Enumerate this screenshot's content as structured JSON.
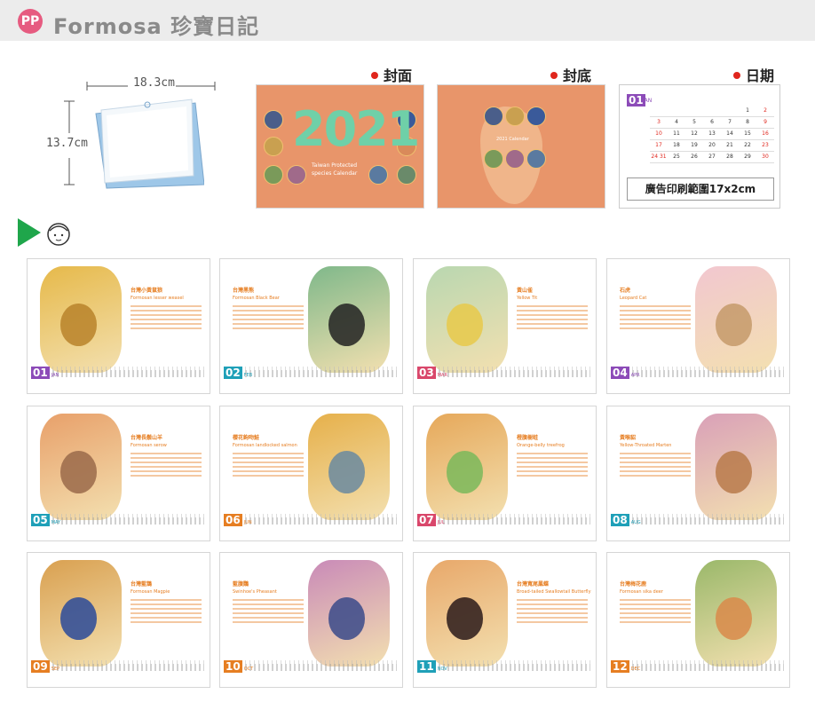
{
  "header": {
    "logo": "PP",
    "title": "Formosa 珍寶日記"
  },
  "dimensions": {
    "width": "18.3cm",
    "height": "13.7cm"
  },
  "sections": [
    {
      "label": "封面"
    },
    {
      "label": "封底"
    },
    {
      "label": "日期"
    }
  ],
  "cover": {
    "year": "2021",
    "subtitle": "Taiwan Protected species Calendar"
  },
  "back": {
    "subtitle": "2021 Calendar"
  },
  "mini_calendar": {
    "num": "01",
    "month": "JAN",
    "rows": [
      [
        "",
        "",
        "",
        "",
        "",
        "1",
        "2"
      ],
      [
        "3",
        "4",
        "5",
        "6",
        "7",
        "8",
        "9"
      ],
      [
        "10",
        "11",
        "12",
        "13",
        "14",
        "15",
        "16"
      ],
      [
        "17",
        "18",
        "19",
        "20",
        "21",
        "22",
        "23"
      ],
      [
        "24 31",
        "25",
        "26",
        "27",
        "28",
        "29",
        "30"
      ]
    ],
    "ad_text": "廣告印刷範圍17x2cm"
  },
  "months": [
    {
      "num": "01",
      "mon": "JAN",
      "color": "#8c4bb8",
      "zh": "台灣小黃鼠狼",
      "en": "Formosan lesser weasel",
      "bg": "#e6b94a",
      "ani": "#b8832a",
      "art_side": "left"
    },
    {
      "num": "02",
      "mon": "FEB",
      "color": "#1fa0b8",
      "zh": "台灣黑熊",
      "en": "Formosan Black Bear",
      "bg": "#7fb88a",
      "ani": "#222",
      "art_side": "right"
    },
    {
      "num": "03",
      "mon": "MAR",
      "color": "#d9476b",
      "zh": "黃山雀",
      "en": "Yellow Tit",
      "bg": "#b9d7b0",
      "ani": "#e8c94a",
      "art_side": "left"
    },
    {
      "num": "04",
      "mon": "APR",
      "color": "#8c4bb8",
      "zh": "石虎",
      "en": "Leopard Cat",
      "bg": "#f2c7d0",
      "ani": "#c49a6a",
      "art_side": "right"
    },
    {
      "num": "05",
      "mon": "MAY",
      "color": "#1fa0b8",
      "zh": "台灣長鬃山羊",
      "en": "Formosan serow",
      "bg": "#e8a06a",
      "ani": "#9a6a4a",
      "art_side": "left"
    },
    {
      "num": "06",
      "mon": "JUN",
      "color": "#e67e22",
      "zh": "櫻花鉤吻鮭",
      "en": "Formosan landlocked salmon",
      "bg": "#e6b04a",
      "ani": "#6a8aa0",
      "art_side": "right"
    },
    {
      "num": "07",
      "mon": "JUL",
      "color": "#d9476b",
      "zh": "橙腹樹蛙",
      "en": "Orange-belly treefrog",
      "bg": "#e6a85a",
      "ani": "#7ab85a",
      "art_side": "left"
    },
    {
      "num": "08",
      "mon": "AUG",
      "color": "#1fa0b8",
      "zh": "黃喉貂",
      "en": "Yellow-Throated Marten",
      "bg": "#d9a0b8",
      "ani": "#b87a4a",
      "art_side": "right"
    },
    {
      "num": "09",
      "mon": "SEP",
      "color": "#e67e22",
      "zh": "台灣藍鵲",
      "en": "Formosan Magpie",
      "bg": "#d9a050",
      "ani": "#2a4a9a",
      "art_side": "left"
    },
    {
      "num": "10",
      "mon": "OCT",
      "color": "#e67e22",
      "zh": "藍腹鷴",
      "en": "Swinhoe's Pheasant",
      "bg": "#c98ab8",
      "ani": "#3a4a8a",
      "art_side": "right"
    },
    {
      "num": "11",
      "mon": "NOV",
      "color": "#1fa0b8",
      "zh": "台灣寬尾鳳蝶",
      "en": "Broad-tailed Swallowtail Butterfly",
      "bg": "#e8a86a",
      "ani": "#2a1a1a",
      "art_side": "left"
    },
    {
      "num": "12",
      "mon": "DEC",
      "color": "#e67e22",
      "zh": "台灣梅花鹿",
      "en": "Formosan sika deer",
      "bg": "#9ab86a",
      "ani": "#d98a4a",
      "art_side": "right"
    }
  ]
}
